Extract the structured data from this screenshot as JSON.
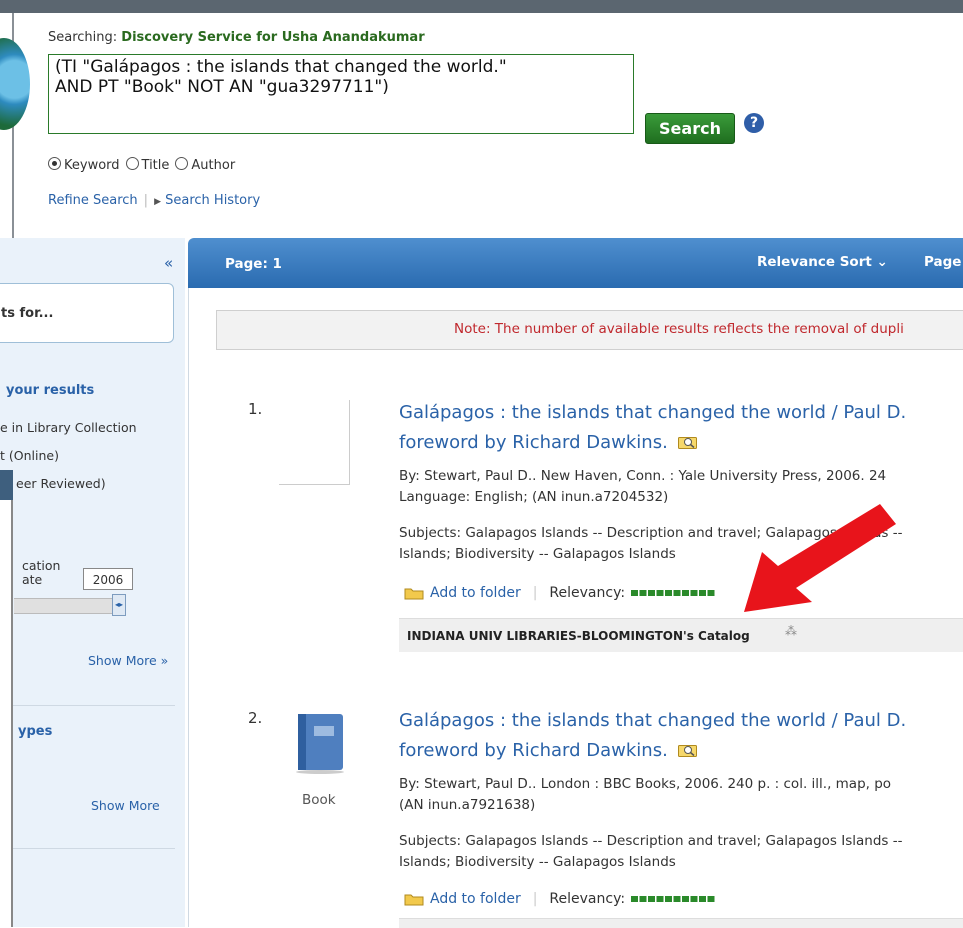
{
  "search": {
    "searching_prefix": "Searching:",
    "database": "Discovery Service for Usha Anandakumar",
    "query": "(TI \"Galápagos : the islands that changed the world.\"\nAND PT \"Book\" NOT AN \"gua3297711\")",
    "search_button": "Search",
    "help": "?",
    "radio_keyword": "Keyword",
    "radio_title": "Title",
    "radio_author": "Author",
    "selected_radio": "Keyword",
    "refine_link": "Refine Search",
    "history_link": "Search History"
  },
  "sidebar": {
    "collapse": "«",
    "results_for": "ts for...",
    "refine_heading": "your results",
    "option1": "e in Library Collection",
    "option2": "t (Online)",
    "option3": "eer Reviewed)",
    "pub_date_label_1": "cation",
    "pub_date_label_2": "ate",
    "year_value": "2006",
    "show_more_1": "Show More »",
    "types_heading": "ypes",
    "show_more_2": "Show More"
  },
  "results_bar": {
    "page_label": "Page: 1",
    "sort_label": "Relevance Sort ⌄",
    "page_options": "Page"
  },
  "note": "Note: The number of available results reflects the removal of dupli",
  "results": [
    {
      "number": "1.",
      "title_line1": "Galápagos : the islands that changed the world / Paul D.",
      "title_line2": "foreword by Richard Dawkins.",
      "byline": "By: Stewart, Paul D.. New Haven, Conn. : Yale University Press, 2006. 24",
      "byline2": "Language: English; (AN inun.a7204532)",
      "subjects1": "Subjects: Galapagos Islands -- Description and travel; Galapagos Islands --",
      "subjects2": "Islands; Biodiversity -- Galapagos Islands",
      "add_folder": "Add to folder",
      "relevancy": "Relevancy:",
      "catalog": "INDIANA UNIV LIBRARIES-BLOOMINGTON's Catalog"
    },
    {
      "number": "2.",
      "thumb_label": "Book",
      "title_line1": "Galápagos : the islands that changed the world / Paul D.",
      "title_line2": "foreword by Richard Dawkins.",
      "byline": "By: Stewart, Paul D.. London : BBC Books, 2006. 240 p. : col. ill., map, po",
      "byline2": "(AN inun.a7921638)",
      "subjects1": "Subjects: Galapagos Islands -- Description and travel; Galapagos Islands --",
      "subjects2": "Islands; Biodiversity -- Galapagos Islands",
      "add_folder": "Add to folder",
      "relevancy": "Relevancy:"
    }
  ],
  "colors": {
    "accent_blue": "#2a62a8",
    "search_green": "#2a7a2a",
    "note_red": "#c0282d",
    "annotation_arrow": "#e8141b"
  }
}
